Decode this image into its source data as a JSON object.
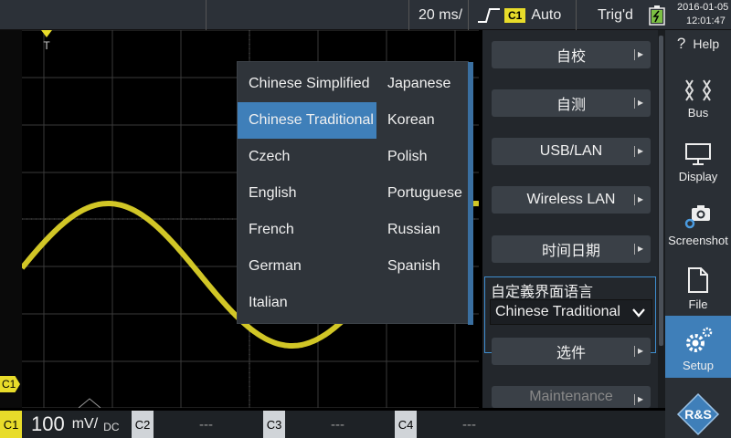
{
  "topbar": {
    "timebase": "20 ms/",
    "trigger_source": "C1",
    "trigger_mode": "Auto",
    "trigger_state": "Trig'd",
    "date": "2016-01-05",
    "time": "12:01:47"
  },
  "waveform": {
    "trigger_marker": "T",
    "channel_marker": "C1",
    "color": "#e8dc2a"
  },
  "language_dropdown": {
    "left_column": [
      "Chinese Simplified",
      "Chinese Traditional",
      "Czech",
      "English",
      "French",
      "German",
      "Italian"
    ],
    "right_column": [
      "Japanese",
      "Korean",
      "Polish",
      "Portuguese",
      "Russian",
      "Spanish"
    ],
    "selected": "Chinese Traditional",
    "highlight_color": "#3f7fb9"
  },
  "menu": {
    "self_align": "自校",
    "self_test": "自测",
    "usb_lan": "USB/LAN",
    "wireless_lan": "Wireless LAN",
    "date_time": "时间日期",
    "language_title": "自定義界面语言",
    "language_value": "Chinese Traditional",
    "options": "选件",
    "maintenance": "Maintenance"
  },
  "sidebar": {
    "help": "Help",
    "bus": "Bus",
    "display": "Display",
    "screenshot": "Screenshot",
    "file": "File",
    "setup": "Setup"
  },
  "bottombar": {
    "c1_label": "C1",
    "c1_scale": "100",
    "c1_unit": "mV/",
    "c1_coupling": "DC",
    "c2_label": "C2",
    "c2_value": "---",
    "c3_label": "C3",
    "c3_value": "---",
    "c4_label": "C4",
    "c4_value": "---"
  }
}
